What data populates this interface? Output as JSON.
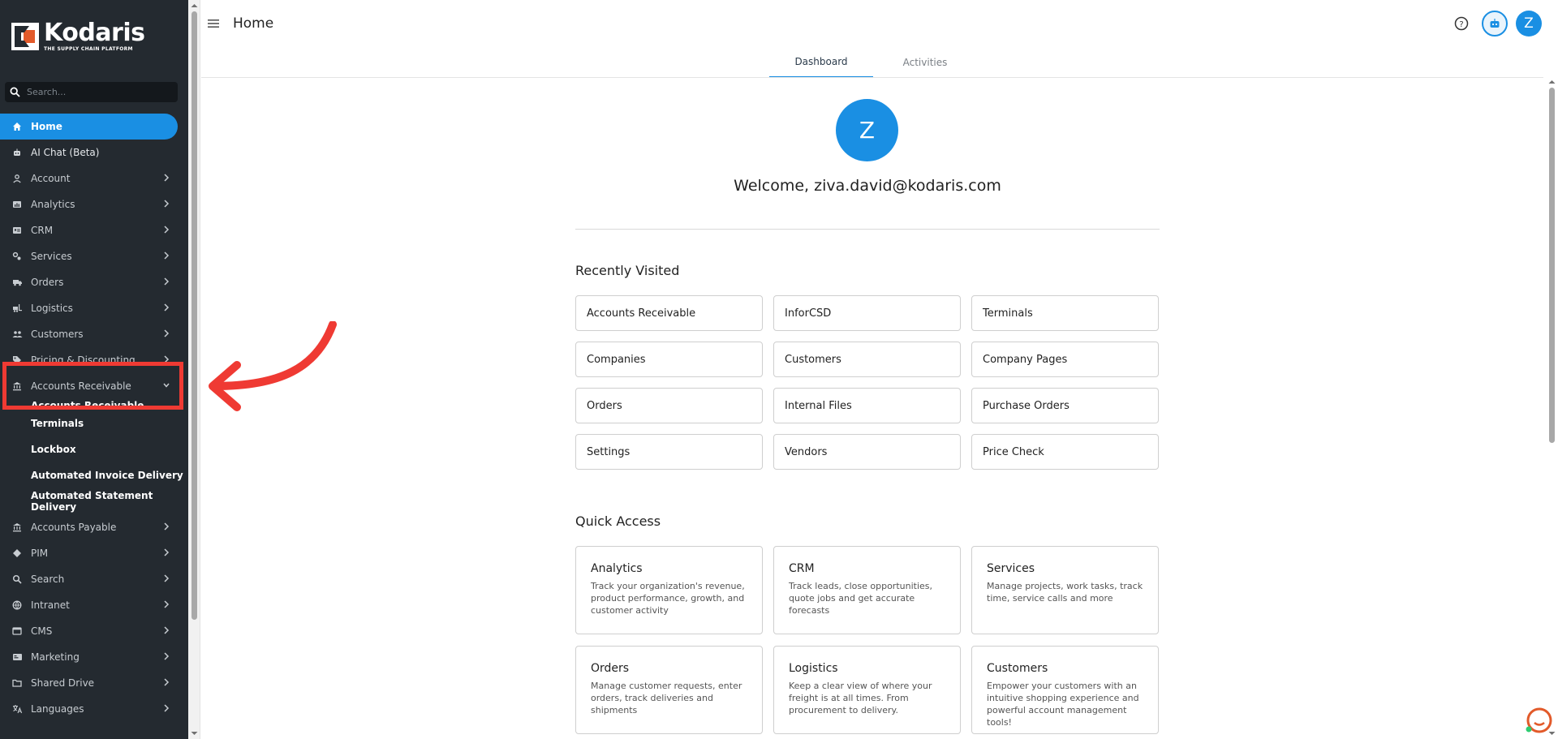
{
  "brand": {
    "name": "Kodaris",
    "tagline": "THE SUPPLY CHAIN PLATFORM"
  },
  "sidebar": {
    "search_placeholder": "Search...",
    "items": [
      {
        "label": "Home",
        "icon": "home-icon",
        "active": true
      },
      {
        "label": "AI Chat (Beta)",
        "icon": "bot-icon"
      },
      {
        "label": "Account",
        "icon": "person-icon"
      },
      {
        "label": "Analytics",
        "icon": "analytics-icon"
      },
      {
        "label": "CRM",
        "icon": "crm-icon"
      },
      {
        "label": "Services",
        "icon": "services-icon"
      },
      {
        "label": "Orders",
        "icon": "truck-icon"
      },
      {
        "label": "Logistics",
        "icon": "forklift-icon"
      },
      {
        "label": "Customers",
        "icon": "people-icon"
      },
      {
        "label": "Pricing & Discounting",
        "icon": "tag-icon"
      },
      {
        "label": "Accounts Receivable",
        "icon": "bank-icon",
        "expanded": true
      },
      {
        "label": "Accounts Payable",
        "icon": "bank-icon"
      },
      {
        "label": "PIM",
        "icon": "diamond-icon"
      },
      {
        "label": "Search",
        "icon": "search-icon"
      },
      {
        "label": "Intranet",
        "icon": "globe-icon"
      },
      {
        "label": "CMS",
        "icon": "cms-icon"
      },
      {
        "label": "Marketing",
        "icon": "marketing-icon"
      },
      {
        "label": "Shared Drive",
        "icon": "folder-icon"
      },
      {
        "label": "Languages",
        "icon": "translate-icon"
      }
    ],
    "ar_subitems": [
      "Accounts Receivable",
      "Terminals",
      "Lockbox",
      "Automated Invoice Delivery",
      "Automated Statement Delivery"
    ]
  },
  "header": {
    "title": "Home",
    "user_initial": "Z"
  },
  "tabs": [
    {
      "label": "Dashboard",
      "active": true
    },
    {
      "label": "Activities",
      "active": false
    }
  ],
  "welcome": {
    "initial": "Z",
    "text": "Welcome, ziva.david@kodaris.com"
  },
  "recently_visited": {
    "title": "Recently Visited",
    "items": [
      "Accounts Receivable",
      "InforCSD",
      "Terminals",
      "Companies",
      "Customers",
      "Company Pages",
      "Orders",
      "Internal Files",
      "Purchase Orders",
      "Settings",
      "Vendors",
      "Price Check"
    ]
  },
  "quick_access": {
    "title": "Quick Access",
    "items": [
      {
        "title": "Analytics",
        "desc": "Track your organization's revenue, product performance, growth, and customer activity"
      },
      {
        "title": "CRM",
        "desc": "Track leads, close opportunities, quote jobs and get accurate forecasts"
      },
      {
        "title": "Services",
        "desc": "Manage projects, work tasks, track time, service calls and more"
      },
      {
        "title": "Orders",
        "desc": "Manage customer requests, enter orders, track deliveries and shipments"
      },
      {
        "title": "Logistics",
        "desc": "Keep a clear view of where your freight is at all times. From procurement to delivery."
      },
      {
        "title": "Customers",
        "desc": "Empower your customers with an intuitive shopping experience and powerful account management tools!"
      }
    ]
  },
  "colors": {
    "accent": "#1a8fe3",
    "sidebar_bg": "#242a30",
    "highlight": "#ef3a33"
  }
}
